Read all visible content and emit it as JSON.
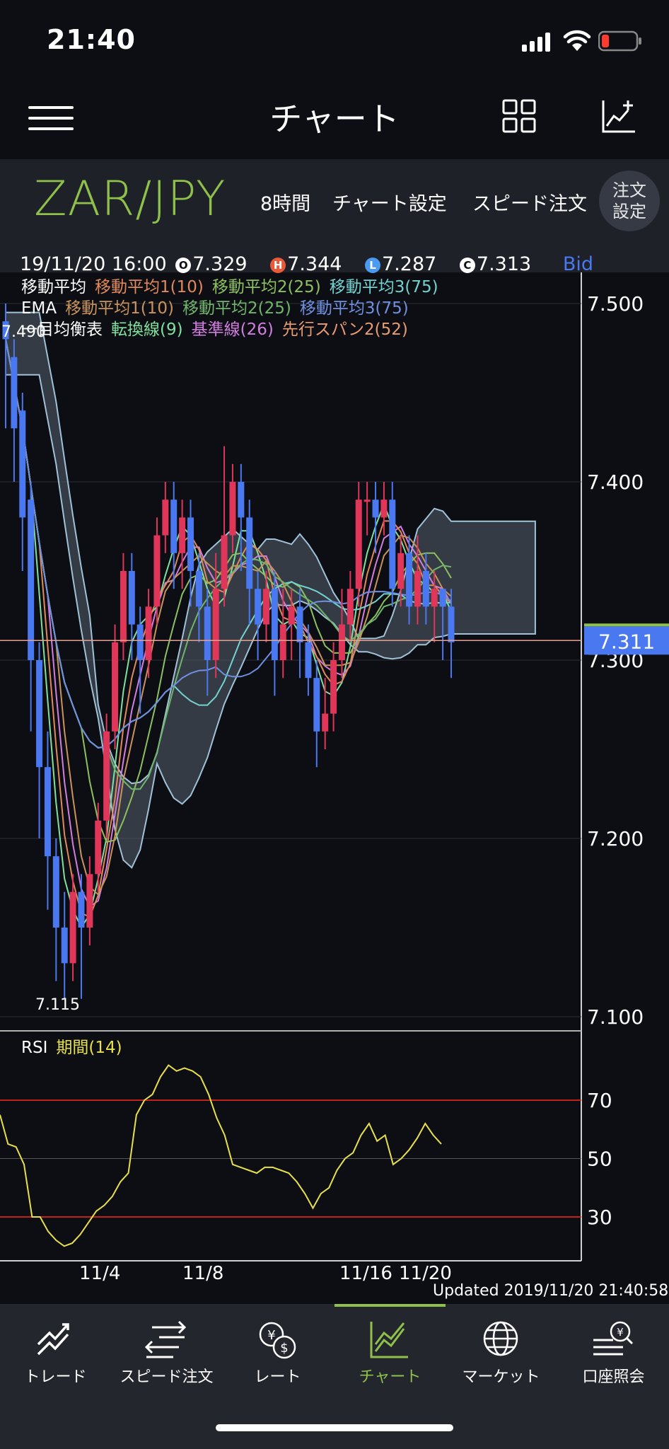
{
  "status_bar": {
    "time": "21:40"
  },
  "nav": {
    "title": "チャート"
  },
  "pair": {
    "name": "ZAR/JPY",
    "timeframe": "8時間",
    "chart_settings": "チャート設定",
    "speed_order": "スピード注文",
    "order_settings_line1": "注文",
    "order_settings_line2": "設定"
  },
  "ohlc": {
    "datetime": "19/11/20 16:00",
    "open_badge": "O",
    "open": "7.329",
    "high_badge": "H",
    "high": "7.344",
    "low_badge": "L",
    "low": "7.287",
    "close_badge": "C",
    "close": "7.313",
    "price_type": "Bid"
  },
  "legends": {
    "sma": {
      "label": "移動平均",
      "items": [
        "移動平均1(10)",
        "移動平均2(25)",
        "移動平均3(75)"
      ]
    },
    "ema": {
      "label": "EMA",
      "items": [
        "移動平均1(10)",
        "移動平均2(25)",
        "移動平均3(75)"
      ]
    },
    "ichimoku": {
      "label": "一目均衡表",
      "items": [
        "転換線(9)",
        "基準線(26)",
        "先行スパン2(52)"
      ]
    }
  },
  "colors": {
    "ma1": "#e0895a",
    "ma2": "#8cc060",
    "ma3": "#72d2d0",
    "ema1": "#c9935c",
    "ema2": "#6fb56a",
    "ema3": "#6f8fe0",
    "tenkan": "#7fe0a0",
    "kijun": "#d27ee0",
    "span2": "#e89c72",
    "up": "#e0365a",
    "down": "#4a78f0",
    "accent": "#8fc04a",
    "rsi": "#e8e04a"
  },
  "rsi": {
    "label": "RSI",
    "period": "期間(14)"
  },
  "footer": {
    "updated": "Updated  2019/11/20 21:40:58"
  },
  "tabs": [
    {
      "label": "トレード",
      "icon": "trade-icon"
    },
    {
      "label": "スピード注文",
      "icon": "speed-order-icon"
    },
    {
      "label": "レート",
      "icon": "rate-icon"
    },
    {
      "label": "チャート",
      "icon": "chart-icon",
      "active": true
    },
    {
      "label": "マーケット",
      "icon": "globe-icon"
    },
    {
      "label": "口座照会",
      "icon": "account-search-icon"
    }
  ],
  "chart_data": {
    "type": "candlestick",
    "symbol": "ZAR/JPY",
    "interval": "8時間",
    "y_ticks": [
      7.5,
      7.4,
      7.3,
      7.2,
      7.1
    ],
    "y_range": [
      7.08,
      7.51
    ],
    "y_tick_labels": [
      "7.500",
      "7.400",
      "7.300",
      "7.200",
      "7.100"
    ],
    "x_tick_labels": [
      "11/4",
      "11/8",
      "11/16",
      "11/20"
    ],
    "current_price": "7.311",
    "high_marker": "7.490",
    "low_marker": "7.115",
    "rsi_ticks": [
      "70",
      "50",
      "30"
    ],
    "rsi_levels": [
      70,
      50,
      30
    ],
    "rsi_range": [
      18,
      85
    ],
    "candles": [
      [
        7.49,
        7.48,
        7.5,
        7.43
      ],
      [
        7.47,
        7.43,
        7.48,
        7.4
      ],
      [
        7.44,
        7.38,
        7.45,
        7.35
      ],
      [
        7.39,
        7.3,
        7.4,
        7.26
      ],
      [
        7.3,
        7.24,
        7.31,
        7.2
      ],
      [
        7.24,
        7.19,
        7.26,
        7.16
      ],
      [
        7.19,
        7.15,
        7.2,
        7.12
      ],
      [
        7.15,
        7.13,
        7.17,
        7.11
      ],
      [
        7.13,
        7.17,
        7.18,
        7.12
      ],
      [
        7.17,
        7.15,
        7.18,
        7.11
      ],
      [
        7.15,
        7.18,
        7.19,
        7.14
      ],
      [
        7.18,
        7.21,
        7.22,
        7.17
      ],
      [
        7.21,
        7.26,
        7.27,
        7.2
      ],
      [
        7.26,
        7.31,
        7.32,
        7.25
      ],
      [
        7.31,
        7.35,
        7.36,
        7.3
      ],
      [
        7.35,
        7.32,
        7.36,
        7.3
      ],
      [
        7.32,
        7.3,
        7.33,
        7.27
      ],
      [
        7.3,
        7.33,
        7.34,
        7.29
      ],
      [
        7.33,
        7.37,
        7.38,
        7.32
      ],
      [
        7.37,
        7.39,
        7.4,
        7.36
      ],
      [
        7.39,
        7.36,
        7.4,
        7.34
      ],
      [
        7.36,
        7.38,
        7.39,
        7.34
      ],
      [
        7.38,
        7.35,
        7.39,
        7.33
      ],
      [
        7.35,
        7.33,
        7.36,
        7.31
      ],
      [
        7.33,
        7.3,
        7.34,
        7.28
      ],
      [
        7.3,
        7.34,
        7.36,
        7.29
      ],
      [
        7.34,
        7.37,
        7.42,
        7.33
      ],
      [
        7.37,
        7.4,
        7.41,
        7.36
      ],
      [
        7.4,
        7.38,
        7.41,
        7.35
      ],
      [
        7.38,
        7.34,
        7.39,
        7.32
      ],
      [
        7.34,
        7.32,
        7.35,
        7.3
      ],
      [
        7.32,
        7.34,
        7.35,
        7.31
      ],
      [
        7.34,
        7.3,
        7.35,
        7.28
      ],
      [
        7.3,
        7.32,
        7.34,
        7.29
      ],
      [
        7.32,
        7.33,
        7.34,
        7.3
      ],
      [
        7.33,
        7.31,
        7.34,
        7.29
      ],
      [
        7.31,
        7.29,
        7.32,
        7.28
      ],
      [
        7.29,
        7.26,
        7.3,
        7.24
      ],
      [
        7.26,
        7.27,
        7.29,
        7.25
      ],
      [
        7.27,
        7.3,
        7.31,
        7.26
      ],
      [
        7.3,
        7.32,
        7.34,
        7.29
      ],
      [
        7.32,
        7.34,
        7.35,
        7.31
      ],
      [
        7.34,
        7.39,
        7.4,
        7.33
      ],
      [
        7.39,
        7.39,
        7.4,
        7.37
      ],
      [
        7.39,
        7.38,
        7.4,
        7.36
      ],
      [
        7.38,
        7.39,
        7.4,
        7.37
      ],
      [
        7.39,
        7.34,
        7.4,
        7.33
      ],
      [
        7.34,
        7.36,
        7.37,
        7.33
      ],
      [
        7.36,
        7.33,
        7.37,
        7.32
      ],
      [
        7.33,
        7.35,
        7.37,
        7.32
      ],
      [
        7.35,
        7.33,
        7.36,
        7.32
      ],
      [
        7.33,
        7.34,
        7.35,
        7.31
      ],
      [
        7.34,
        7.33,
        7.34,
        7.3
      ],
      [
        7.33,
        7.31,
        7.34,
        7.29
      ]
    ],
    "rsi_values": [
      65,
      55,
      54,
      48,
      30,
      30,
      25,
      22,
      20,
      21,
      24,
      28,
      32,
      34,
      37,
      42,
      45,
      65,
      70,
      72,
      78,
      82,
      80,
      81,
      80,
      78,
      72,
      64,
      58,
      48,
      47,
      46,
      45,
      47,
      47,
      46,
      45,
      42,
      38,
      33,
      38,
      40,
      46,
      50,
      52,
      58,
      62,
      56,
      58,
      48,
      50,
      53,
      57,
      62,
      58,
      55
    ]
  }
}
